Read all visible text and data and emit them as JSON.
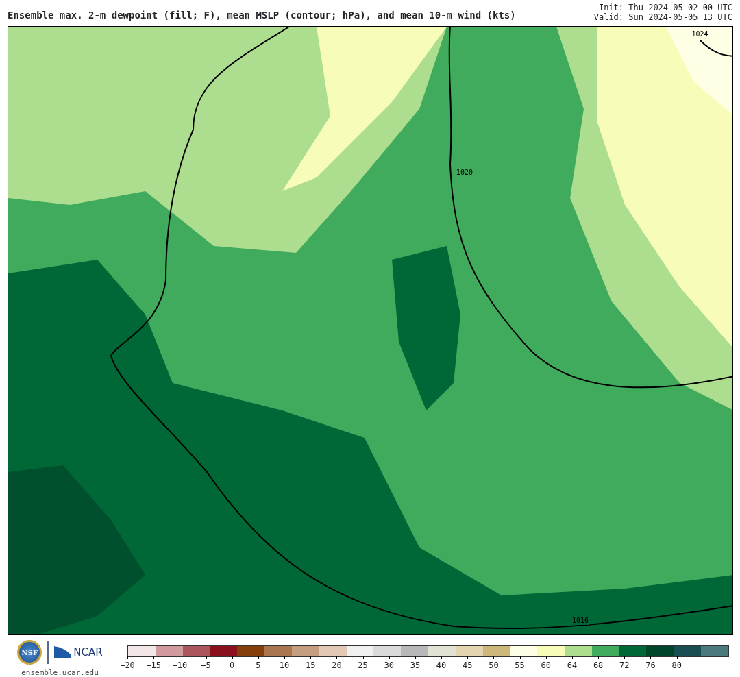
{
  "header": {
    "title": "Ensemble max. 2-m dewpoint (fill; F), mean MSLP (contour; hPa), and mean 10-m wind (kts)",
    "init": "Init: Thu 2024-05-02 00 UTC",
    "valid": "Valid: Sun 2024-05-05 13 UTC"
  },
  "map": {
    "contour_labels": [
      {
        "text": "1024"
      },
      {
        "text": "1020"
      },
      {
        "text": "1016"
      }
    ]
  },
  "footer": {
    "logo_left": "NSF",
    "logo_right": "NCAR",
    "site": "ensemble.ucar.edu"
  },
  "colorbar": {
    "ticks": [
      "−20",
      "−15",
      "−10",
      "−5",
      "0",
      "5",
      "10",
      "15",
      "20",
      "25",
      "30",
      "35",
      "40",
      "45",
      "50",
      "55",
      "60",
      "64",
      "68",
      "72",
      "76",
      "80"
    ]
  }
}
